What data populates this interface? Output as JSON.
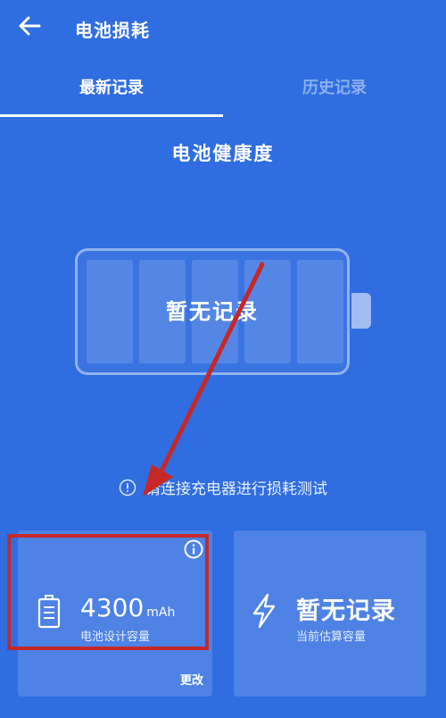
{
  "header": {
    "title": "电池损耗"
  },
  "tabs": [
    {
      "label": "最新记录",
      "active": true
    },
    {
      "label": "历史记录",
      "active": false
    }
  ],
  "section": {
    "title": "电池健康度"
  },
  "battery": {
    "status_text": "暂无记录"
  },
  "hint": {
    "text": "请连接充电器进行损耗测试"
  },
  "cards": {
    "design": {
      "value": "4300",
      "unit": "mAh",
      "caption": "电池设计容量",
      "action": "更改"
    },
    "estimated": {
      "value": "暂无记录",
      "caption": "当前估算容量"
    }
  },
  "colors": {
    "background": "#2f6de0",
    "annotation": "#c62828"
  },
  "icons": {
    "back": "arrow-left-icon",
    "info": "info-icon",
    "hint": "exclamation-circle-icon",
    "battery": "battery-icon",
    "bolt": "lightning-bolt-icon"
  }
}
